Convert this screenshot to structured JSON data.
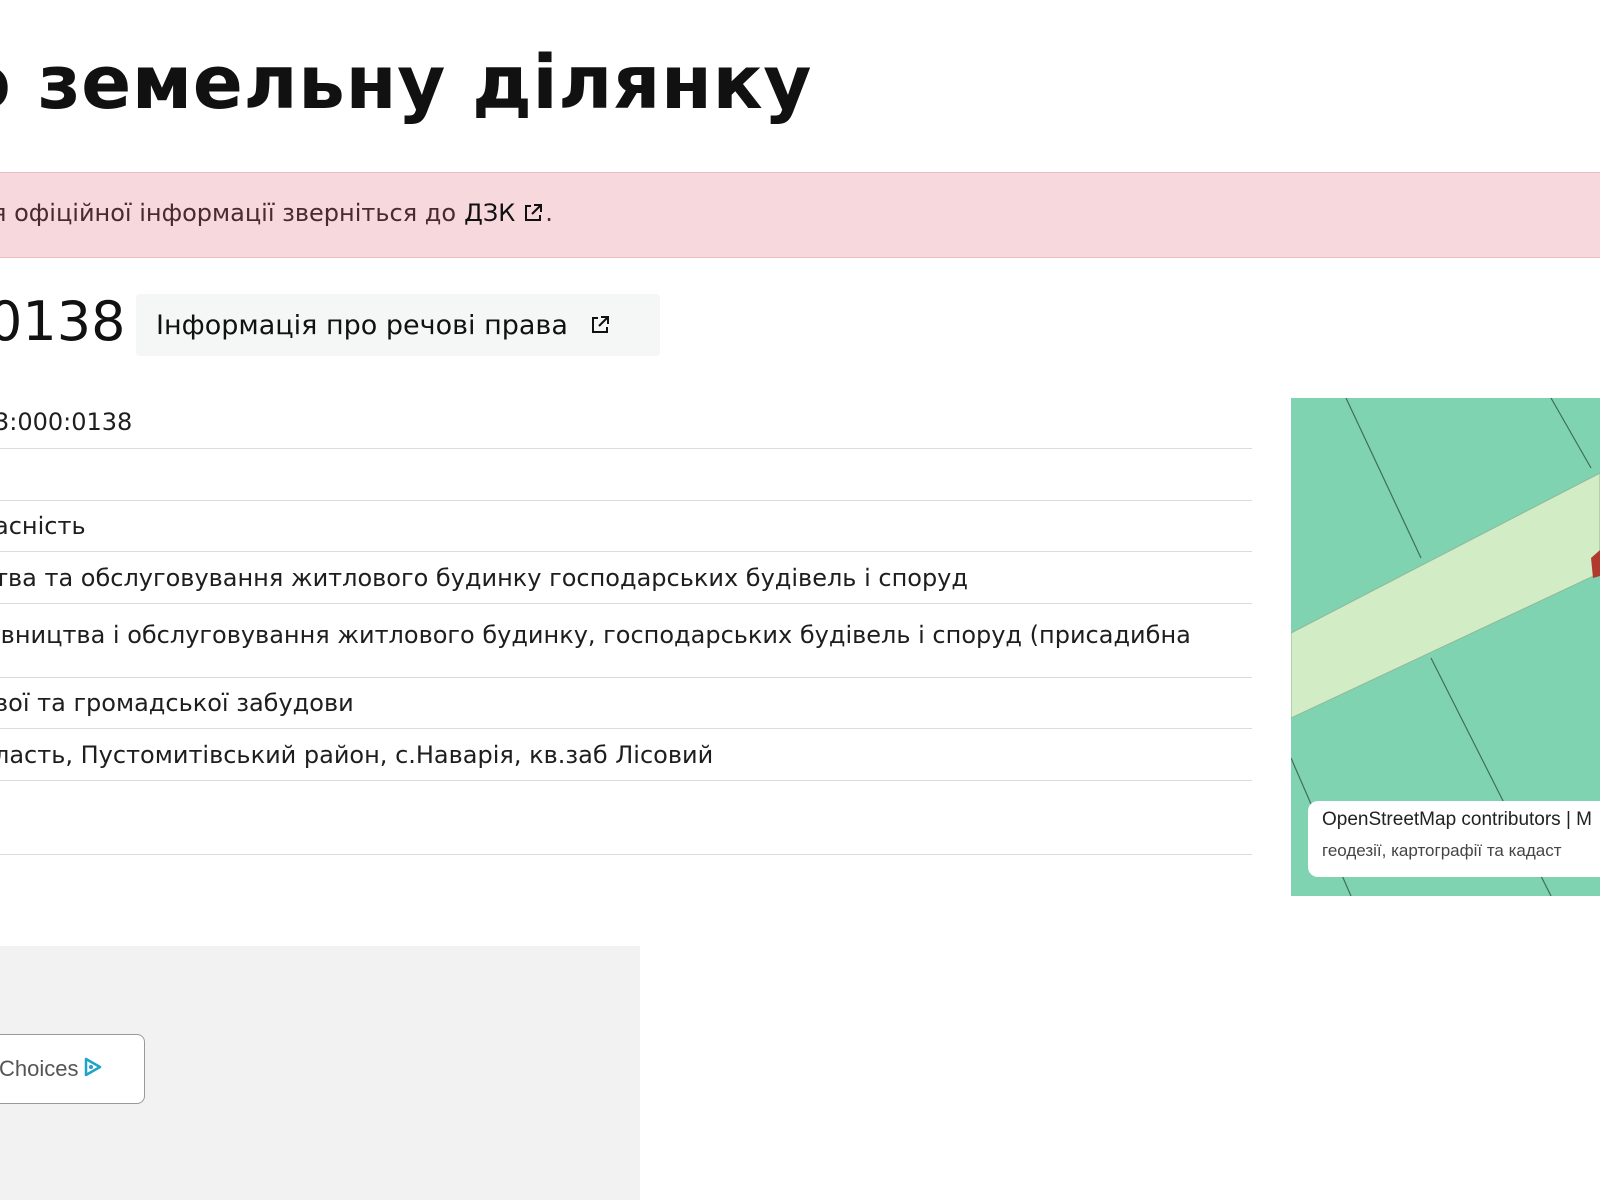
{
  "page": {
    "title": "о земельну ділянку"
  },
  "alert": {
    "text": "я офіційної інформації зверніться до",
    "link_label": "ДЗК",
    "suffix": "."
  },
  "parcel": {
    "id": "0138",
    "rights_button_label": "Інформація про речові права"
  },
  "info_rows": [
    "3:000:0138",
    "",
    "асність",
    "тва та обслуговування житлового будинку господарських будівель і споруд",
    "івництва і обслуговування житлового будинку, господарських будівель і споруд (присадибна",
    "вої та громадської забудови",
    "ласть, Пустомитівський район, с.Наварія, кв.заб Лісовий",
    ""
  ],
  "map": {
    "attribution_line1": "OpenStreetMap contributors | M",
    "attribution_line2": "геодезії, картографії та кадаст",
    "colors": {
      "parcel_fill": "#7fd3b0",
      "road_fill": "#d2ecc6",
      "highlight": "#b03a2e"
    }
  },
  "ad": {
    "adchoices_label": "Choices",
    "icon": "adchoices-icon"
  },
  "icons": {
    "external_link": "external-link-icon"
  }
}
